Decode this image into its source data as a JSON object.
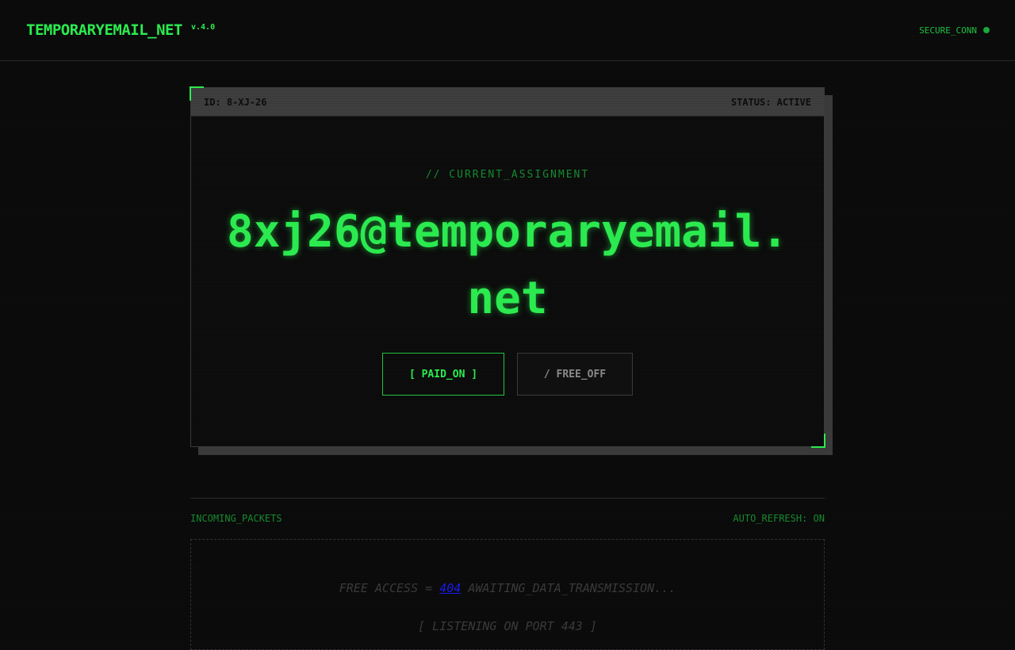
{
  "header": {
    "brand": "TEMPORARYEMAIL_NET",
    "version": "v.4.0",
    "connection_status": "SECURE_CONN"
  },
  "card": {
    "id_label": "ID: 8-XJ-26",
    "status_label": "STATUS: ACTIVE",
    "assignment_label": "// CURRENT_ASSIGNMENT",
    "email": "8xj26@temporaryemail.net",
    "buttons": {
      "paid": "[ PAID_ON ]",
      "free": "/ FREE_OFF"
    }
  },
  "inbox": {
    "section_label": "INCOMING_PACKETS",
    "auto_refresh": "AUTO_REFRESH: ON",
    "message_prefix": "FREE ACCESS = ",
    "message_link": "404",
    "message_suffix": " AWAITING_DATA_TRANSMISSION...",
    "listening": "[ LISTENING ON PORT 443 ]"
  },
  "colors": {
    "accent": "#2bea4f",
    "background": "#0a0a0a",
    "panel_bar": "#3f3f3f"
  }
}
